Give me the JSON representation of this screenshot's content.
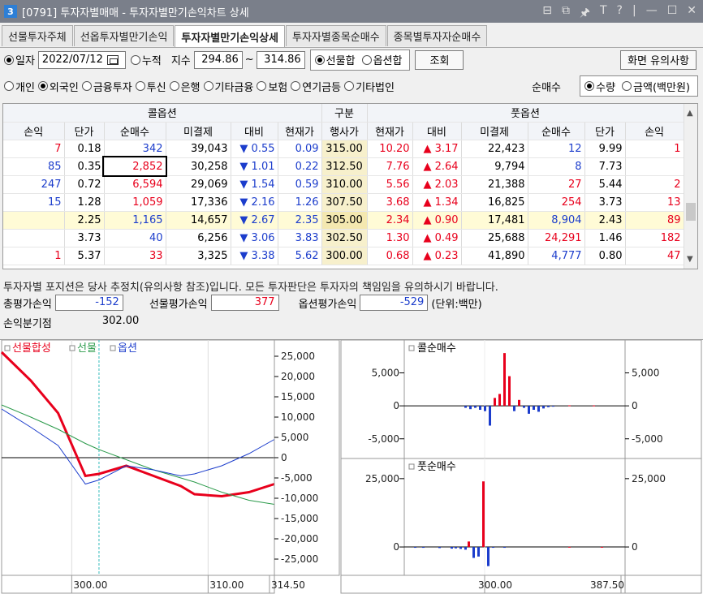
{
  "window": {
    "num": "3",
    "title": "[0791] 투자자별매매 - 투자자별만기손익차트 상세",
    "controls": [
      "⊟",
      "⧉",
      "🖈",
      "T",
      "?",
      "|",
      "—",
      "☐",
      "✕"
    ]
  },
  "tabs": [
    "선물투자주체",
    "선옵투자별만기손익",
    "투자자별만기손익상세",
    "투자자별종목순매수",
    "종목별투자자순매수"
  ],
  "filters": {
    "day_label": "일자",
    "date": "2022/07/12",
    "cumulative_label": "누적",
    "index_label": "지수",
    "index_from": "294.86",
    "index_sep": "~",
    "index_to": "314.86",
    "futures_sum": "선물합",
    "option_sum": "옵션합",
    "query_button": "조회",
    "notice_button": "화면 유의사항"
  },
  "investors": [
    "개인",
    "외국인",
    "금융투자",
    "투신",
    "은행",
    "기타금융",
    "보험",
    "연기금등",
    "기타법인"
  ],
  "selected_investor": "외국인",
  "net_buy": {
    "label": "순매수",
    "qty": "수량",
    "amount": "금액(백만원)"
  },
  "table": {
    "call_header": "콜옵션",
    "class_header": "구분",
    "put_header": "풋옵션",
    "columns": [
      "손익",
      "단가",
      "순매수",
      "미결제",
      "대비",
      "현재가",
      "행사가",
      "현재가",
      "대비",
      "미결제",
      "순매수",
      "단가",
      "손익"
    ],
    "rows": [
      {
        "c_pl": "7",
        "c_price": "0.18",
        "c_net": "342",
        "c_oi": "39,043",
        "c_chg": "▼ 0.55",
        "c_cur": "0.09",
        "strike": "315.00",
        "p_cur": "10.20",
        "p_chg": "▲ 3.17",
        "p_oi": "22,423",
        "p_net": "12",
        "p_price": "9.99",
        "p_pl": "1"
      },
      {
        "c_pl": "85",
        "c_price": "0.35",
        "c_net": "2,852",
        "c_oi": "30,258",
        "c_chg": "▼ 1.01",
        "c_cur": "0.22",
        "strike": "312.50",
        "p_cur": "7.76",
        "p_chg": "▲ 2.64",
        "p_oi": "9,794",
        "p_net": "8",
        "p_price": "7.73",
        "p_pl": ""
      },
      {
        "c_pl": "247",
        "c_price": "0.72",
        "c_net": "6,594",
        "c_oi": "29,069",
        "c_chg": "▼ 1.54",
        "c_cur": "0.59",
        "strike": "310.00",
        "p_cur": "5.56",
        "p_chg": "▲ 2.03",
        "p_oi": "21,388",
        "p_net": "27",
        "p_price": "5.44",
        "p_pl": "2"
      },
      {
        "c_pl": "15",
        "c_price": "1.28",
        "c_net": "1,059",
        "c_oi": "17,336",
        "c_chg": "▼ 2.16",
        "c_cur": "1.26",
        "strike": "307.50",
        "p_cur": "3.68",
        "p_chg": "▲ 1.34",
        "p_oi": "16,825",
        "p_net": "254",
        "p_price": "3.73",
        "p_pl": "13"
      },
      {
        "c_pl": "",
        "c_price": "2.25",
        "c_net": "1,165",
        "c_oi": "14,657",
        "c_chg": "▼ 2.67",
        "c_cur": "2.35",
        "strike": "305.00",
        "p_cur": "2.34",
        "p_chg": "▲ 0.90",
        "p_oi": "17,481",
        "p_net": "8,904",
        "p_price": "2.43",
        "p_pl": "89"
      },
      {
        "c_pl": "",
        "c_price": "3.73",
        "c_net": "40",
        "c_oi": "6,256",
        "c_chg": "▼ 3.06",
        "c_cur": "3.83",
        "strike": "302.50",
        "p_cur": "1.30",
        "p_chg": "▲ 0.49",
        "p_oi": "25,688",
        "p_net": "24,291",
        "p_price": "1.46",
        "p_pl": "182"
      },
      {
        "c_pl": "1",
        "c_price": "5.37",
        "c_net": "33",
        "c_oi": "3,325",
        "c_chg": "▼ 3.38",
        "c_cur": "5.62",
        "strike": "300.00",
        "p_cur": "0.68",
        "p_chg": "▲ 0.23",
        "p_oi": "41,890",
        "p_net": "4,777",
        "p_price": "0.80",
        "p_pl": "47"
      }
    ]
  },
  "notice": "투자자별 포지션은 당사 추정치(유의사항 참조)입니다. 모든 투자판단은 투자자의 책임임을 유의하시기 바랍니다.",
  "summary": {
    "total_label": "총평가손익",
    "total_value": "-152",
    "fut_label": "선물평가손익",
    "fut_value": "377",
    "opt_label": "옵션평가손익",
    "opt_value": "-529",
    "unit": "(단위:백만)",
    "bep_label": "손익분기점",
    "bep_value": "302.00"
  },
  "colors": {
    "red": "#e8001c",
    "blue": "#1c3dcc",
    "green": "#2a9a4a"
  },
  "chart_data": [
    {
      "type": "line",
      "legend": [
        "선물합성",
        "선물",
        "옵션"
      ],
      "x_ticks": [
        "300.00",
        "310.00",
        "314.50"
      ],
      "y_ticks": [
        "25,000",
        "20,000",
        "15,000",
        "10,000",
        "5,000",
        "0",
        "-5,000",
        "-10,000",
        "-15,000",
        "-20,000",
        "-25,000"
      ],
      "x": [
        294.86,
        297,
        299,
        301,
        302,
        304,
        306,
        308,
        309,
        311,
        313,
        314.86
      ],
      "series": [
        {
          "name": "선물합성",
          "values": [
            26000,
            19000,
            11000,
            -4500,
            -4000,
            -2000,
            -4500,
            -7000,
            -9000,
            -9500,
            -8500,
            -6500
          ]
        },
        {
          "name": "선물",
          "values": [
            13000,
            10000,
            7000,
            3500,
            2000,
            -500,
            -3000,
            -5000,
            -6000,
            -8500,
            -10500,
            -11500
          ]
        },
        {
          "name": "옵션",
          "values": [
            12000,
            7500,
            3000,
            -6500,
            -5500,
            -2000,
            -3000,
            -4500,
            -4000,
            -2000,
            1000,
            4500
          ]
        }
      ],
      "ylim": [
        -27000,
        27000
      ],
      "vline": 302
    },
    {
      "type": "bar",
      "legend": [
        "콜순매수"
      ],
      "y_ticks": [
        "5,000",
        "0",
        "-5,000"
      ],
      "ylim": [
        -7000,
        9000
      ]
    },
    {
      "type": "bar",
      "legend": [
        "풋순매수"
      ],
      "y_ticks": [
        "25,000",
        "0"
      ],
      "x_ticks": [
        "300.00",
        "387.50"
      ],
      "ylim": [
        -8000,
        30000
      ]
    }
  ]
}
